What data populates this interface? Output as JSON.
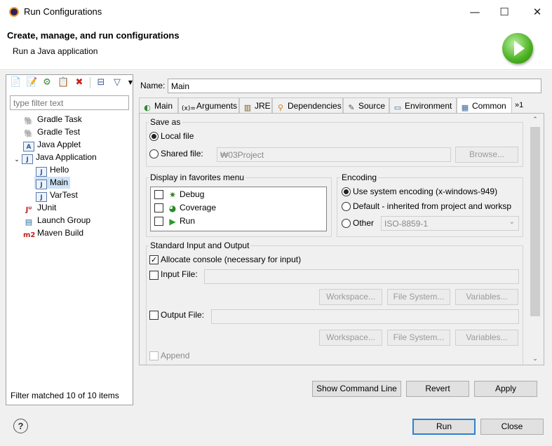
{
  "window": {
    "title": "Run Configurations",
    "minimize_glyph": "—",
    "maximize_glyph": "☐",
    "close_glyph": "✕"
  },
  "header": {
    "title": "Create, manage, and run configurations",
    "subtitle": "Run a Java application"
  },
  "left": {
    "filter_placeholder": "type filter text",
    "tree": [
      {
        "label": "Gradle Task",
        "icon": "gradle-elephant-icon"
      },
      {
        "label": "Gradle Test",
        "icon": "gradle-elephant-icon"
      },
      {
        "label": "Java Applet",
        "icon": "java-applet-icon"
      },
      {
        "label": "Java Application",
        "icon": "java-application-icon",
        "expanded": true
      },
      {
        "label": "Hello",
        "icon": "java-class-icon"
      },
      {
        "label": "Main",
        "icon": "java-class-icon",
        "selected": true
      },
      {
        "label": "VarTest",
        "icon": "java-class-icon"
      },
      {
        "label": "JUnit",
        "icon": "junit-icon"
      },
      {
        "label": "Launch Group",
        "icon": "launch-group-icon"
      },
      {
        "label": "Maven Build",
        "icon": "maven-icon"
      }
    ],
    "status": "Filter matched 10 of 10 items"
  },
  "config": {
    "name_label": "Name:",
    "name_value": "Main",
    "tabs": [
      {
        "label": "Main",
        "icon": "main-tab-icon"
      },
      {
        "label": "Arguments",
        "icon": "arguments-icon"
      },
      {
        "label": "JRE",
        "icon": "jre-icon"
      },
      {
        "label": "Dependencies",
        "icon": "dependencies-icon"
      },
      {
        "label": "Source",
        "icon": "source-icon"
      },
      {
        "label": "Environment",
        "icon": "environment-icon"
      },
      {
        "label": "Common",
        "icon": "common-icon",
        "active": true
      },
      {
        "label": "»1",
        "icon": "overflow-tabs-icon"
      }
    ],
    "save_as": {
      "title": "Save as",
      "local_file": "Local file",
      "shared_file": "Shared file:",
      "shared_path": "₩03Project",
      "browse": "Browse..."
    },
    "favorites": {
      "title": "Display in favorites menu",
      "items": [
        "Debug",
        "Coverage",
        "Run"
      ]
    },
    "encoding": {
      "title": "Encoding",
      "use_system": "Use system encoding (x-windows-949)",
      "default_inherited": "Default - inherited from project and worksp",
      "other": "Other",
      "other_value": "ISO-8859-1"
    },
    "stdio": {
      "title": "Standard Input and Output",
      "allocate_console": "Allocate console (necessary for input)",
      "input_file": "Input File:",
      "output_file": "Output File:",
      "workspace": "Workspace...",
      "file_system": "File System...",
      "variables": "Variables...",
      "append": "Append"
    },
    "buttons": {
      "show_command_line": "Show Command Line",
      "revert": "Revert",
      "apply": "Apply"
    }
  },
  "footer": {
    "help_glyph": "?",
    "run": "Run",
    "close": "Close"
  }
}
